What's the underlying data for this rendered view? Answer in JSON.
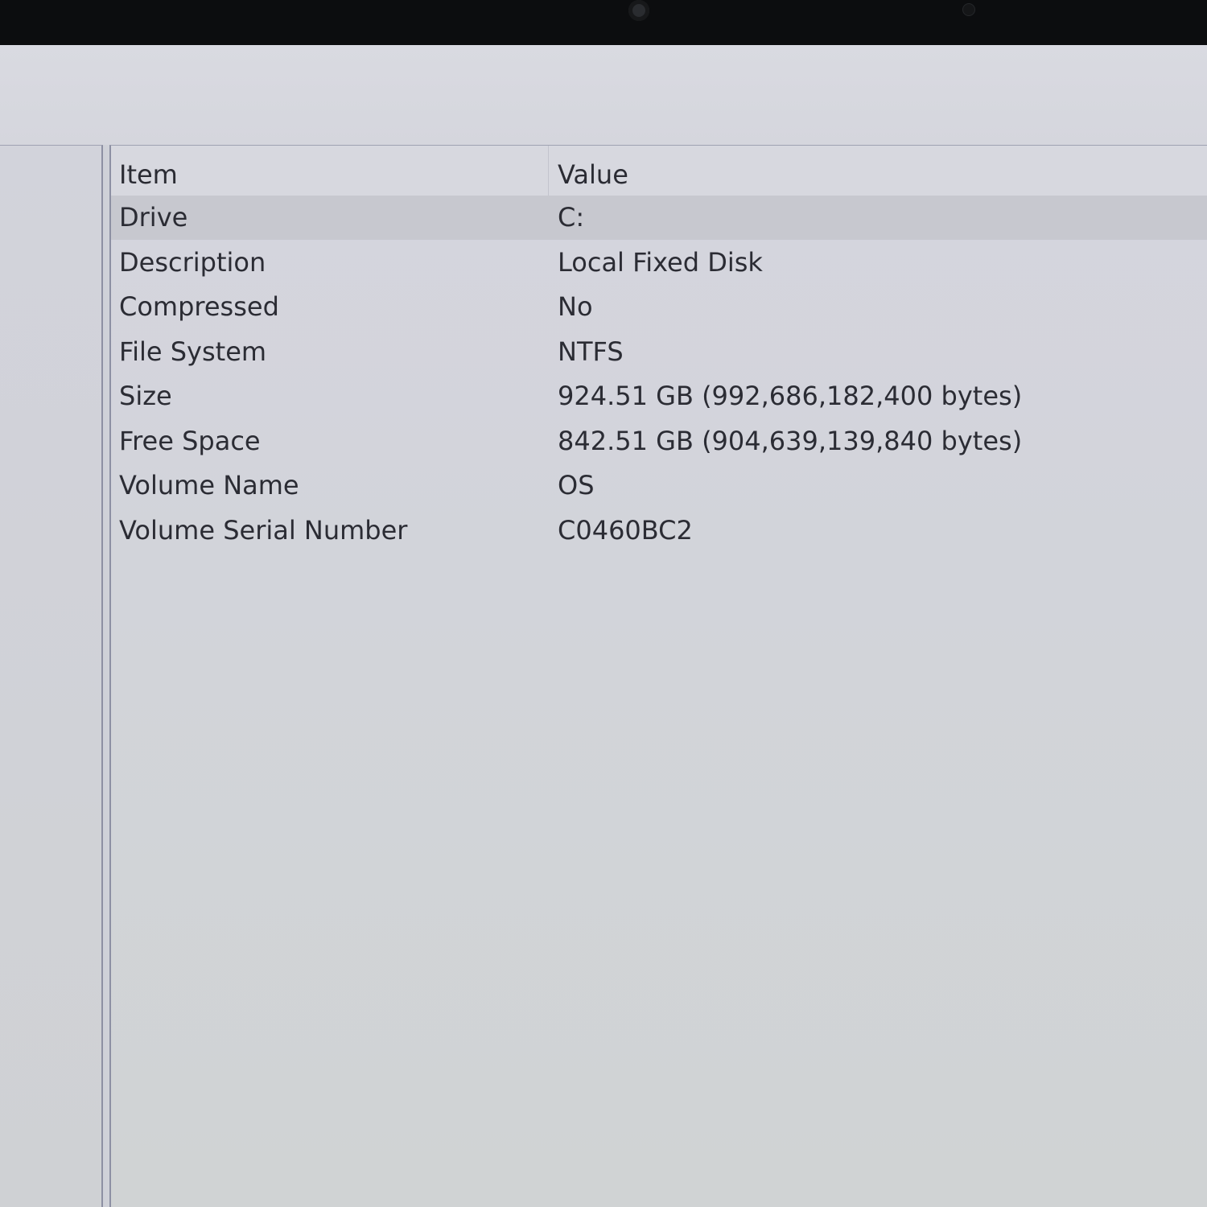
{
  "table": {
    "columns": [
      "Item",
      "Value"
    ],
    "rows": [
      {
        "item": "Drive",
        "value": "C:"
      },
      {
        "item": "Description",
        "value": "Local Fixed Disk"
      },
      {
        "item": "Compressed",
        "value": "No"
      },
      {
        "item": "File System",
        "value": "NTFS"
      },
      {
        "item": "Size",
        "value": "924.51 GB (992,686,182,400 bytes)"
      },
      {
        "item": "Free Space",
        "value": "842.51 GB (904,639,139,840 bytes)"
      },
      {
        "item": "Volume Name",
        "value": "OS"
      },
      {
        "item": "Volume Serial Number",
        "value": "C0460BC2"
      }
    ],
    "selected_row": 0
  },
  "colors": {
    "bezel": "#0c0d0f",
    "background": "#d3d6da",
    "text": "#2b2c34",
    "selection": "#c7c8cf"
  }
}
